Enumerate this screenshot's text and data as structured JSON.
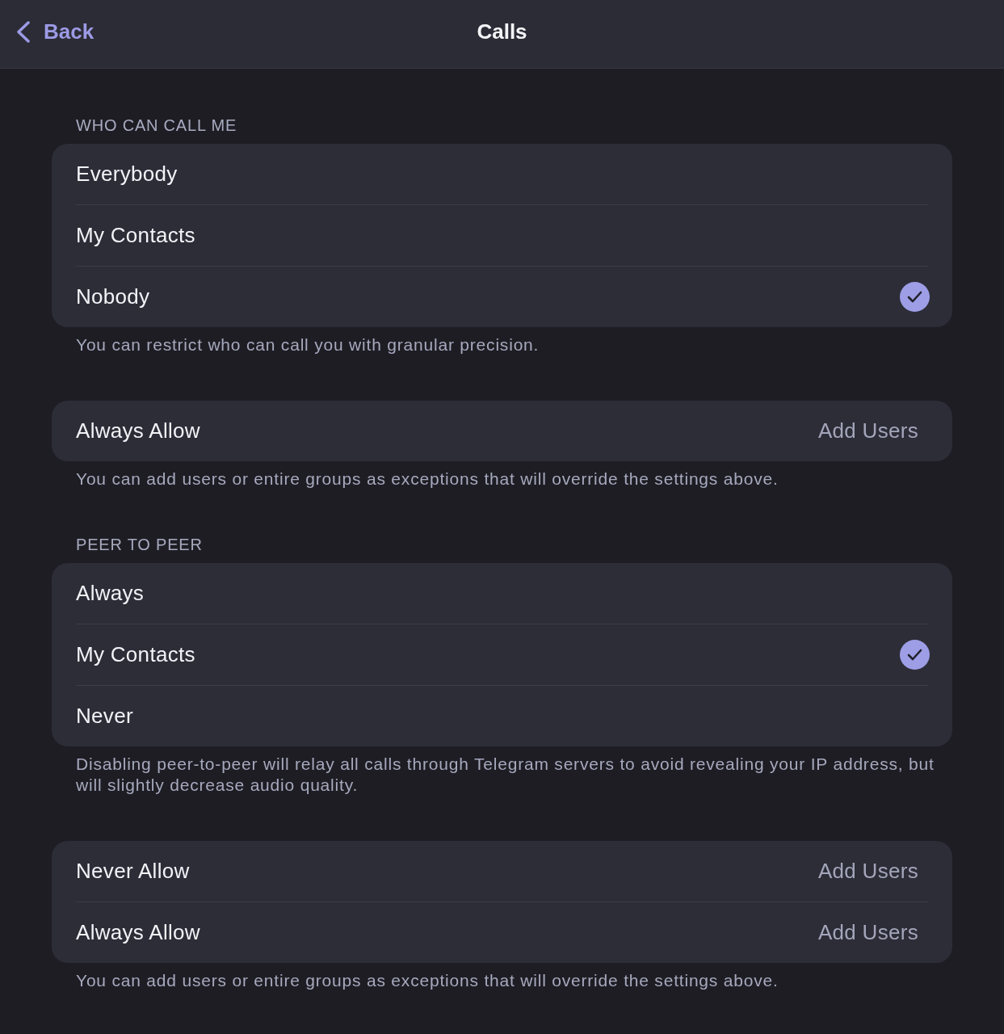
{
  "nav_bar": {
    "back": "Back",
    "title": "Calls"
  },
  "sections": [
    {
      "header": "WHO CAN CALL ME",
      "rows": [
        {
          "kind": "option",
          "label": "Everybody",
          "selected": false
        },
        {
          "kind": "option",
          "label": "My Contacts",
          "selected": false
        },
        {
          "kind": "option",
          "label": "Nobody",
          "selected": true
        }
      ],
      "footer": "You can restrict who can call you with granular precision."
    },
    {
      "rows": [
        {
          "kind": "link",
          "label": "Always Allow",
          "action": "Add Users"
        }
      ],
      "footer": "You can add users or entire groups as exceptions that will override the settings above."
    },
    {
      "header": "PEER TO PEER",
      "rows": [
        {
          "kind": "option",
          "label": "Always",
          "selected": false
        },
        {
          "kind": "option",
          "label": "My Contacts",
          "selected": true
        },
        {
          "kind": "option",
          "label": "Never",
          "selected": false
        }
      ],
      "footer": "Disabling peer-to-peer will relay all calls through Telegram servers to avoid revealing your IP address, but will slightly decrease audio quality."
    },
    {
      "rows": [
        {
          "kind": "link",
          "label": "Never Allow",
          "action": "Add Users"
        },
        {
          "kind": "link",
          "label": "Always Allow",
          "action": "Add Users"
        }
      ],
      "footer": "You can add users or entire groups as exceptions that will override the settings above."
    }
  ]
}
